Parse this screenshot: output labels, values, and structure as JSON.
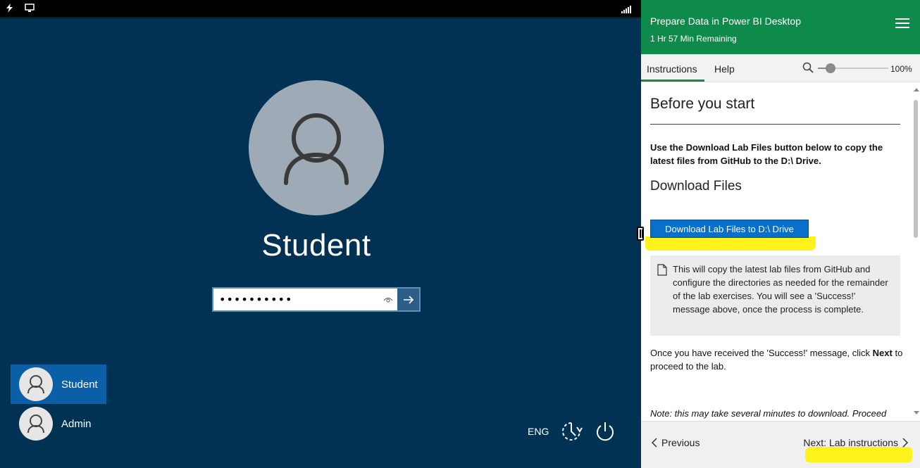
{
  "vm": {
    "user_display_name": "Student",
    "password_value": "••••••••••",
    "users": [
      {
        "name": "Student",
        "selected": true
      },
      {
        "name": "Admin",
        "selected": false
      }
    ],
    "language": "ENG",
    "icons": {
      "topbar_left": [
        "lightning-icon",
        "monitor-icon"
      ],
      "topbar_right": "signal-icon",
      "avatar": "user-silhouette-icon",
      "password_reveal": "eye-icon",
      "submit": "arrow-right-icon",
      "accessibility": "ease-of-access-icon",
      "power": "power-icon"
    },
    "colors": {
      "background": "#013253",
      "selected_tile": "#0a5fa6"
    }
  },
  "panel": {
    "header": {
      "title": "Prepare Data in Power BI Desktop",
      "time_remaining": "1 Hr 57 Min Remaining"
    },
    "tabs": [
      {
        "label": "Instructions",
        "active": true
      },
      {
        "label": "Help",
        "active": false
      }
    ],
    "zoom": {
      "value_label": "100%",
      "level_percent": 100
    },
    "content": {
      "heading_before": "Before you start",
      "bold_intro": "Use the Download Lab Files button below to copy the latest files from GitHub to the D:\\ Drive.",
      "heading_download": "Download Files",
      "download_button_label": "Download Lab Files to D:\\ Drive",
      "note_text": "This will copy the latest lab files from GitHub and configure the directories as needed for the remainder of the lab exercises. You will see a 'Success!' message above, once the process is complete.",
      "once_prefix": "Once you have received the 'Success!' message, click ",
      "once_bold": "Next",
      "once_suffix": " to proceed to the lab.",
      "partial_note": "Note: this may take several minutes to download. Proceed"
    },
    "footer": {
      "previous_label": "Previous",
      "next_label": "Next: Lab instructions"
    },
    "colors": {
      "header": "#0e8a4a",
      "button": "#0a6fc9",
      "highlight": "#fdf21a"
    }
  }
}
